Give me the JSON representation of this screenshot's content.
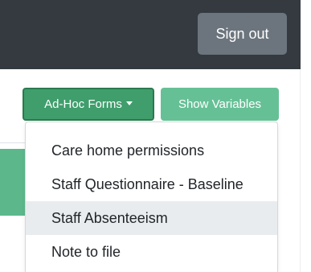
{
  "navbar": {
    "sign_out_label": "Sign out"
  },
  "toolbar": {
    "adhoc_forms_label": "Ad-Hoc Forms",
    "show_variables_label": "Show Variables"
  },
  "dropdown": {
    "items": [
      {
        "label": "Care home permissions"
      },
      {
        "label": "Staff Questionnaire - Baseline"
      },
      {
        "label": "Staff Absenteeism",
        "highlighted": true
      },
      {
        "label": "Note to file"
      }
    ]
  },
  "colors": {
    "navbar_bg": "#343a40",
    "secondary_button": "#6c757d",
    "success_button": "#3f9e6c",
    "success_light": "#66c096",
    "hover_bg": "#e9ecef"
  }
}
